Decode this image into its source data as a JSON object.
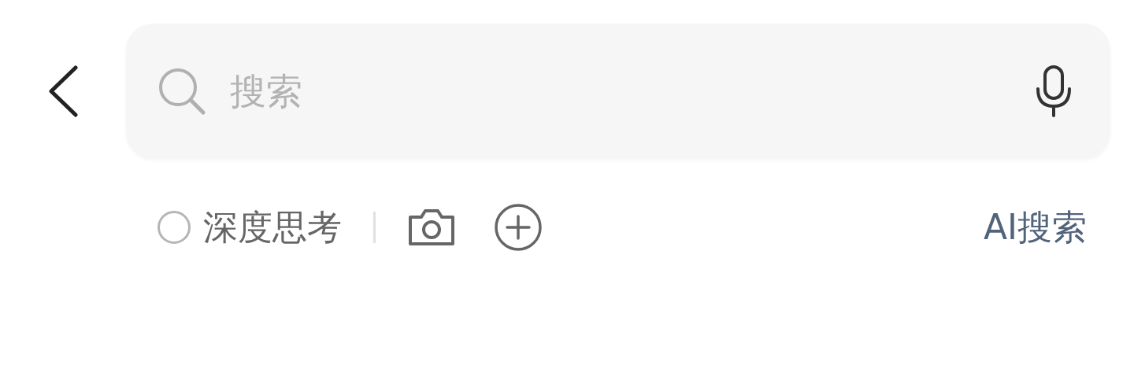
{
  "search": {
    "placeholder": "搜索"
  },
  "deep_thinking": {
    "label": "深度思考",
    "checked": false
  },
  "ai_search": {
    "label": "AI搜索"
  }
}
